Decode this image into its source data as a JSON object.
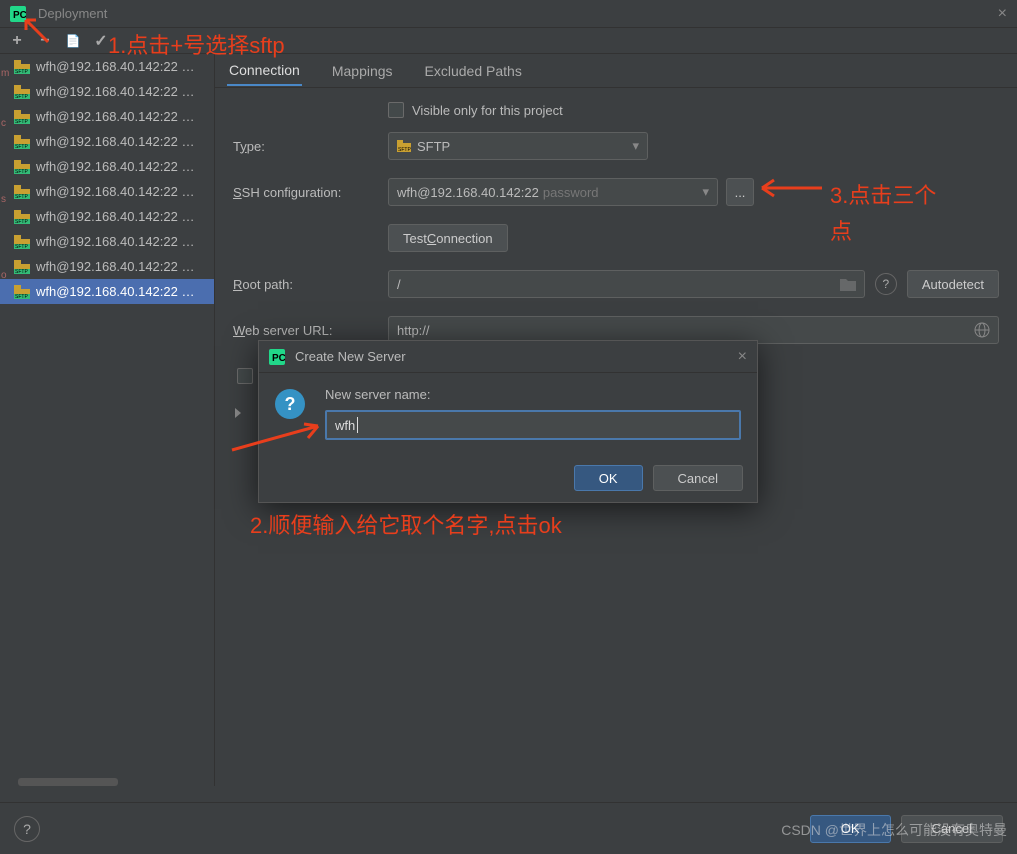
{
  "window": {
    "title": "Deployment"
  },
  "toolbar": {
    "add": "+",
    "remove": "−",
    "copy": "📄",
    "apply": "✓"
  },
  "sidebar": {
    "items": [
      {
        "label": "wfh@192.168.40.142:22 …"
      },
      {
        "label": "wfh@192.168.40.142:22 …"
      },
      {
        "label": "wfh@192.168.40.142:22 …"
      },
      {
        "label": "wfh@192.168.40.142:22 …"
      },
      {
        "label": "wfh@192.168.40.142:22 …"
      },
      {
        "label": "wfh@192.168.40.142:22 …"
      },
      {
        "label": "wfh@192.168.40.142:22 …"
      },
      {
        "label": "wfh@192.168.40.142:22 …"
      },
      {
        "label": "wfh@192.168.40.142:22 …"
      },
      {
        "label": "wfh@192.168.40.142:22 …"
      }
    ],
    "selected_index": 9
  },
  "tabs": {
    "connection": "Connection",
    "mappings": "Mappings",
    "excluded": "Excluded Paths"
  },
  "form": {
    "visible_only": "Visible only for this project",
    "type_label_pre": "T",
    "type_label_ul": "y",
    "type_label_post": "pe:",
    "type_value": "SFTP",
    "ssh_label_pre": "",
    "ssh_label_ul": "S",
    "ssh_label_post": "SH configuration:",
    "ssh_value": "wfh@192.168.40.142:22",
    "ssh_hint": "password",
    "test_btn_pre": "Test ",
    "test_btn_ul": "C",
    "test_btn_post": "onnection",
    "root_label_pre": "",
    "root_label_ul": "R",
    "root_label_post": "oot path:",
    "root_value": "/",
    "autodetect": "Autodetect",
    "url_label_pre": "",
    "url_label_ul": "W",
    "url_label_post": "eb server URL:",
    "url_value": "http://",
    "dots": "..."
  },
  "modal": {
    "title": "Create New Server",
    "field_label": "New server name:",
    "value": "wfh",
    "ok": "OK",
    "cancel": "Cancel"
  },
  "footer": {
    "ok": "OK",
    "cancel": "Cancel"
  },
  "annotations": {
    "a1": "1.点击+号选择sftp",
    "a2": "2.顺便输入给它取个名字,点击ok",
    "a3a": "3.点击三个",
    "a3b": "点"
  },
  "watermark": "CSDN @世界上怎么可能没有奥特曼"
}
